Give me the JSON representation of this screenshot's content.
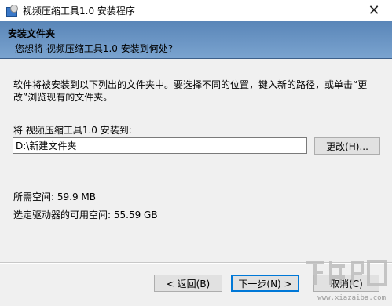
{
  "window": {
    "title": "视频压缩工具1.0 安装程序",
    "close_glyph": "✕"
  },
  "header": {
    "title": "安装文件夹",
    "subtitle": "您想将 视频压缩工具1.0 安装到何处?"
  },
  "body": {
    "description": "软件将被安装到以下列出的文件夹中。要选择不同的位置，键入新的路径，或单击“更改”浏览现有的文件夹。",
    "install_label": "将 视频压缩工具1.0 安装到:",
    "path_value": "D:\\新建文件夹",
    "change_button": "更改(H)...",
    "space_required": "所需空间: 59.9 MB",
    "space_available": "选定驱动器的可用空间: 55.59 GB"
  },
  "footer": {
    "back_button": "< 返回(B)",
    "next_button": "下一步(N) >",
    "cancel_button": "取消(C)"
  },
  "watermark": {
    "text": "www.xiazaiba.com"
  },
  "colors": {
    "header_gradient_top": "#5a86b8",
    "header_gradient_bottom": "#7aa3cf",
    "focus_accent": "#0078d7"
  }
}
